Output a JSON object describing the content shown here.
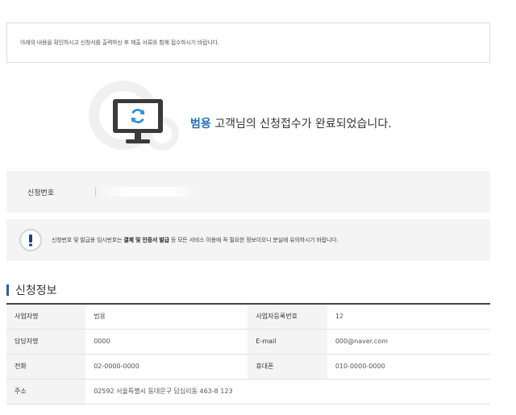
{
  "notice": {
    "text": "아래의 내용을 확인하시고 신청서를 출력하신 후 제출 서류와 함께 접수하시기 바랍니다."
  },
  "hero": {
    "customer_name": "범용",
    "message": " 고객님의 신청접수가 완료되었습니다.",
    "icon": "refresh-monitor-icon"
  },
  "application_number": {
    "label": "신청번호",
    "value": ""
  },
  "alert": {
    "icon": "exclamation-icon",
    "text_prefix": "신청번호 및 발급용 임시번호는 ",
    "text_bold1": "결제 및 인증서 발급",
    "text_suffix": " 등 모든 서비스 이용에 꼭 필요한 정보이오니 분실에 유의하시기 바랍니다."
  },
  "section": {
    "title": "신청정보"
  },
  "info": {
    "rows": [
      {
        "label1": "사업자명",
        "value1": "범용",
        "label2": "사업자등록번호",
        "value2": "12"
      },
      {
        "label1": "담당자명",
        "value1": "0000",
        "label2": "E-mail",
        "value2": "000@naver.com"
      },
      {
        "label1": "전화",
        "value1": "02-0000-0000",
        "label2": "휴대폰",
        "value2": "010-0000-0000"
      }
    ],
    "address": {
      "label": "주소",
      "value": "02592  서울특별시 동대문구 답십리동 463-8 123"
    }
  },
  "colors": {
    "accent": "#2a6db5",
    "section_bar": "#2a5fa5",
    "band_bg": "#f4f4f4"
  }
}
